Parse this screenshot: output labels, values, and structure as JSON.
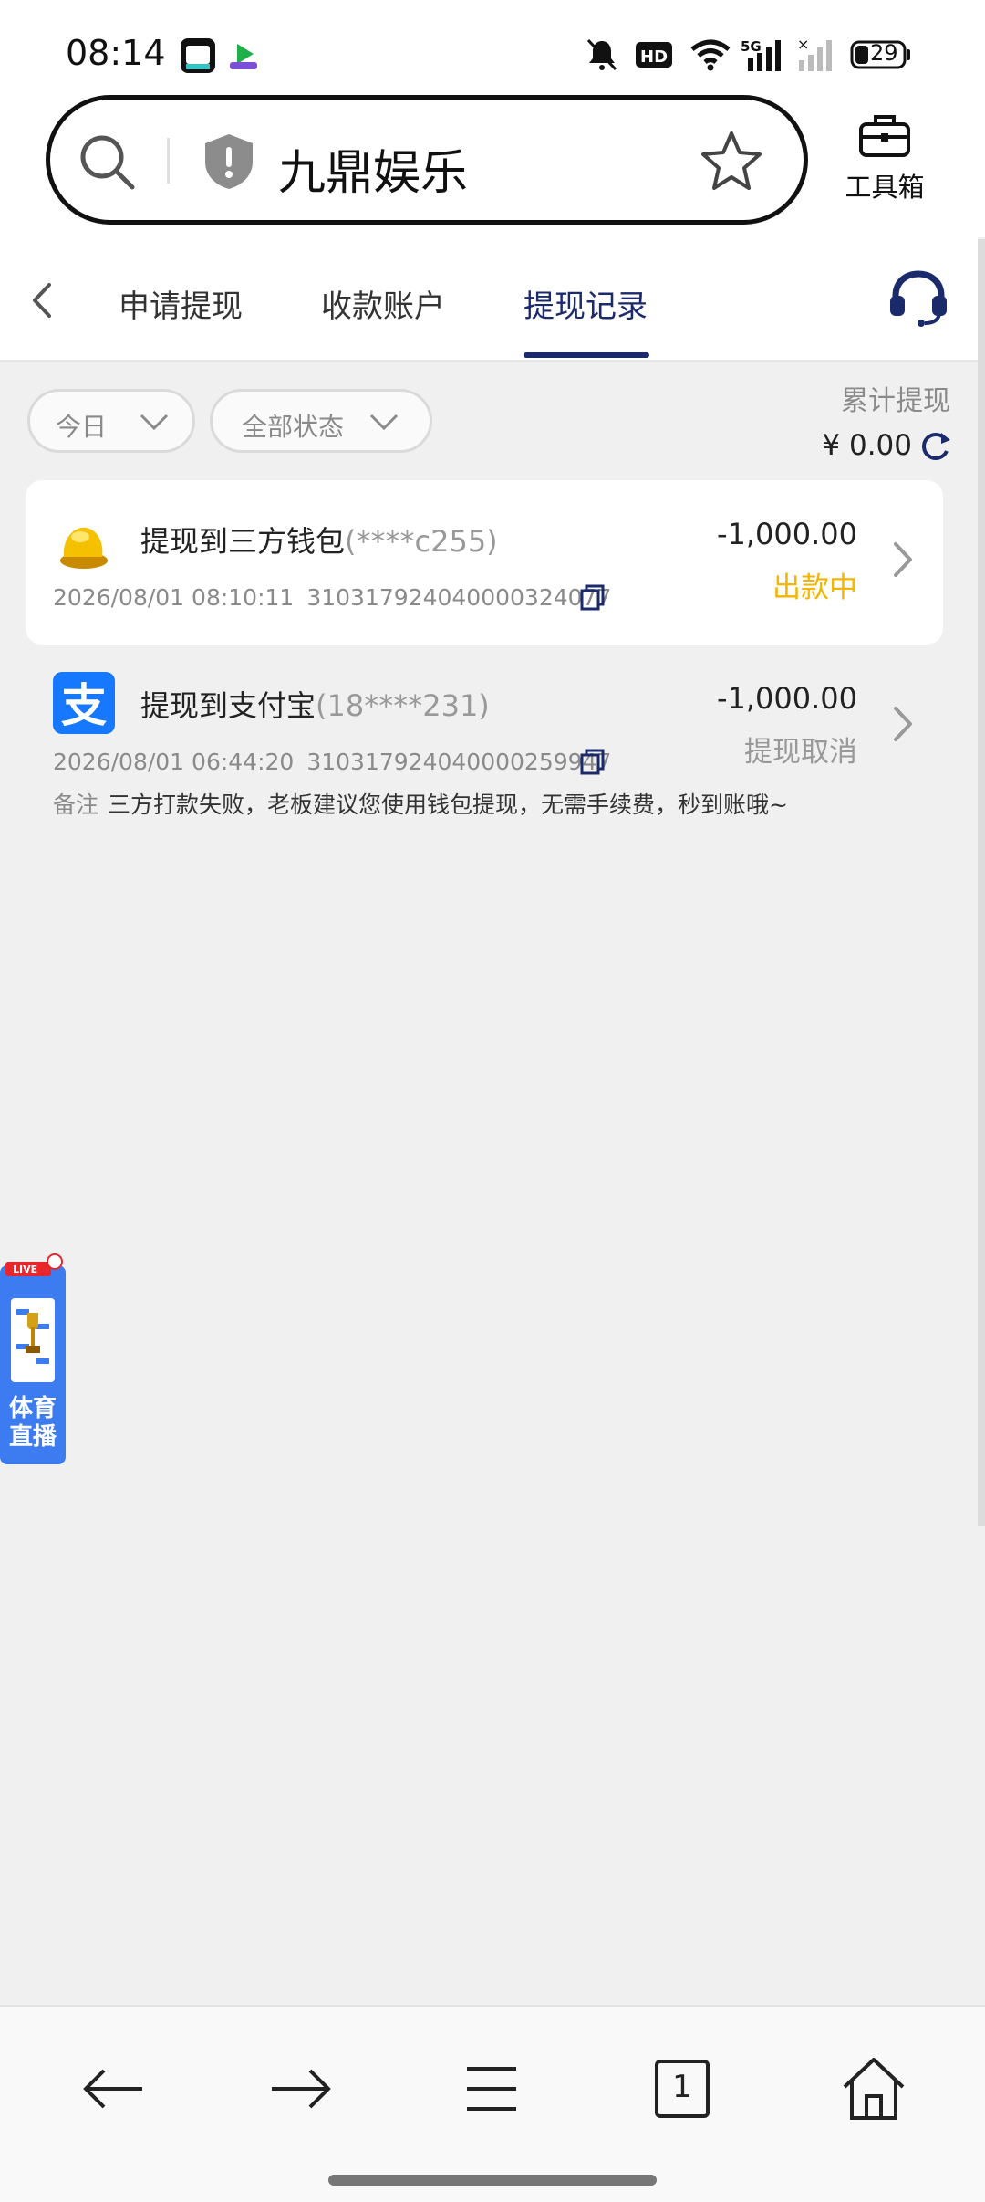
{
  "status_bar": {
    "time": "08:14",
    "battery": "29",
    "network": "5G",
    "icons": [
      "mute-icon",
      "hd-icon",
      "wifi-icon",
      "signal-icon",
      "battery-icon"
    ]
  },
  "browser": {
    "url_text": "九鼎娱乐",
    "toolbox_label": "工具箱"
  },
  "tabs": [
    {
      "label": "申请提现"
    },
    {
      "label": "收款账户"
    },
    {
      "label": "提现记录"
    }
  ],
  "active_tab": "提现记录",
  "filters": {
    "date": "今日",
    "status": "全部状态"
  },
  "summary": {
    "label": "累计提现",
    "value": "¥ 0.00"
  },
  "records": [
    {
      "title": "提现到三方钱包",
      "account": "(****c255)",
      "datetime": "2026/08/01 08:10:11",
      "order_id": "310317924040000324077",
      "amount": "-1,000.00",
      "status": "出款中"
    },
    {
      "title": "提现到支付宝",
      "account": "(18****231)",
      "datetime": "2026/08/01 06:44:20",
      "order_id": "310317924040000259947",
      "amount": "-1,000.00",
      "status": "提现取消",
      "note_label": "备注",
      "note": "三方打款失败，老板建议您使用钱包提现，无需手续费，秒到账哦~"
    }
  ],
  "live_badge": {
    "tag": "LIVE",
    "line1": "体育",
    "line2": "直播"
  },
  "bottom_nav": {
    "tab_count": "1"
  },
  "colors": {
    "accent": "#1b2a6b",
    "status_pending": "#f4b400",
    "status_cancel": "#999999",
    "alipay": "#1677ff",
    "live_blue": "#3d7bf0"
  }
}
